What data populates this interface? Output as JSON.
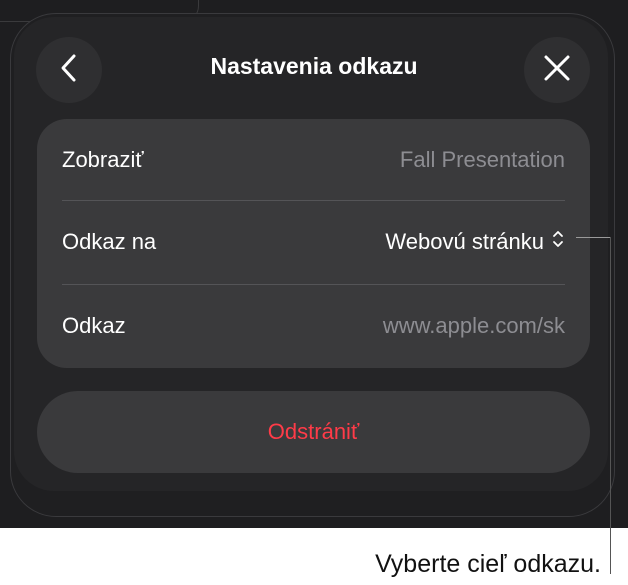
{
  "header": {
    "title": "Nastavenia odkazu",
    "back_icon": "chevron-left-icon",
    "close_icon": "close-icon"
  },
  "settings": {
    "rows": [
      {
        "label": "Zobraziť",
        "value": "Fall Presentation"
      },
      {
        "label": "Odkaz na",
        "value": "Webovú stránku",
        "icon": "chevron-up-down-icon"
      },
      {
        "label": "Odkaz",
        "value": "www.apple.com/sk"
      }
    ]
  },
  "actions": {
    "delete_label": "Odstrániť"
  },
  "callout": {
    "text": "Vyberte cieľ odkazu."
  },
  "colors": {
    "background": "#1e1e20",
    "group": "#3a3a3c",
    "destructive": "#ff3b48",
    "muted_text": "#8d8d92"
  }
}
